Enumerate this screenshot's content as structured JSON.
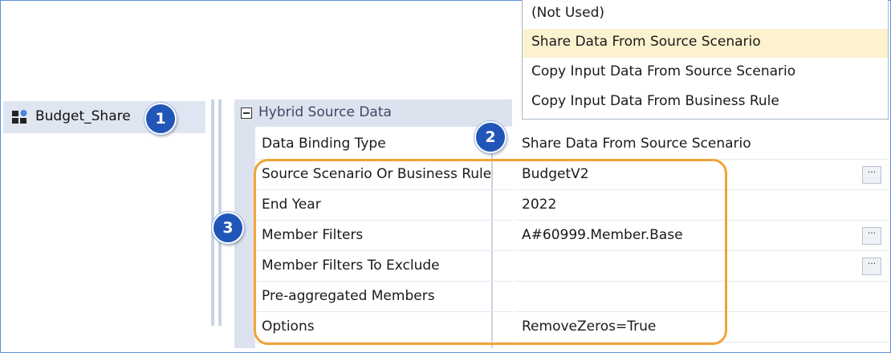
{
  "tree": {
    "item_label": "Budget_Share"
  },
  "badges": [
    "1",
    "2",
    "3"
  ],
  "dropdown": {
    "options": [
      "(Not Used)",
      "Share Data From Source Scenario",
      "Copy Input Data From Source Scenario",
      "Copy Input Data From Business Rule"
    ],
    "selected_index": 1
  },
  "grid": {
    "category": "Hybrid Source Data",
    "rows": [
      {
        "name": "Data Binding Type",
        "value": "Share Data From Source Scenario",
        "button": false
      },
      {
        "name": "Source Scenario Or Business Rule",
        "value": "BudgetV2",
        "button": true
      },
      {
        "name": "End Year",
        "value": "2022",
        "button": false
      },
      {
        "name": "Member Filters",
        "value": "A#60999.Member.Base",
        "button": true
      },
      {
        "name": "Member Filters To Exclude",
        "value": "",
        "button": true
      },
      {
        "name": "Pre-aggregated Members",
        "value": "",
        "button": false
      },
      {
        "name": "Options",
        "value": "RemoveZeros=True",
        "button": false
      }
    ],
    "ellipsis_label": "···"
  },
  "colors": {
    "badge": "#2156b8",
    "highlight": "#f2a33a",
    "selected_option": "#fdf2d0",
    "category_bg": "#dde3ee"
  }
}
